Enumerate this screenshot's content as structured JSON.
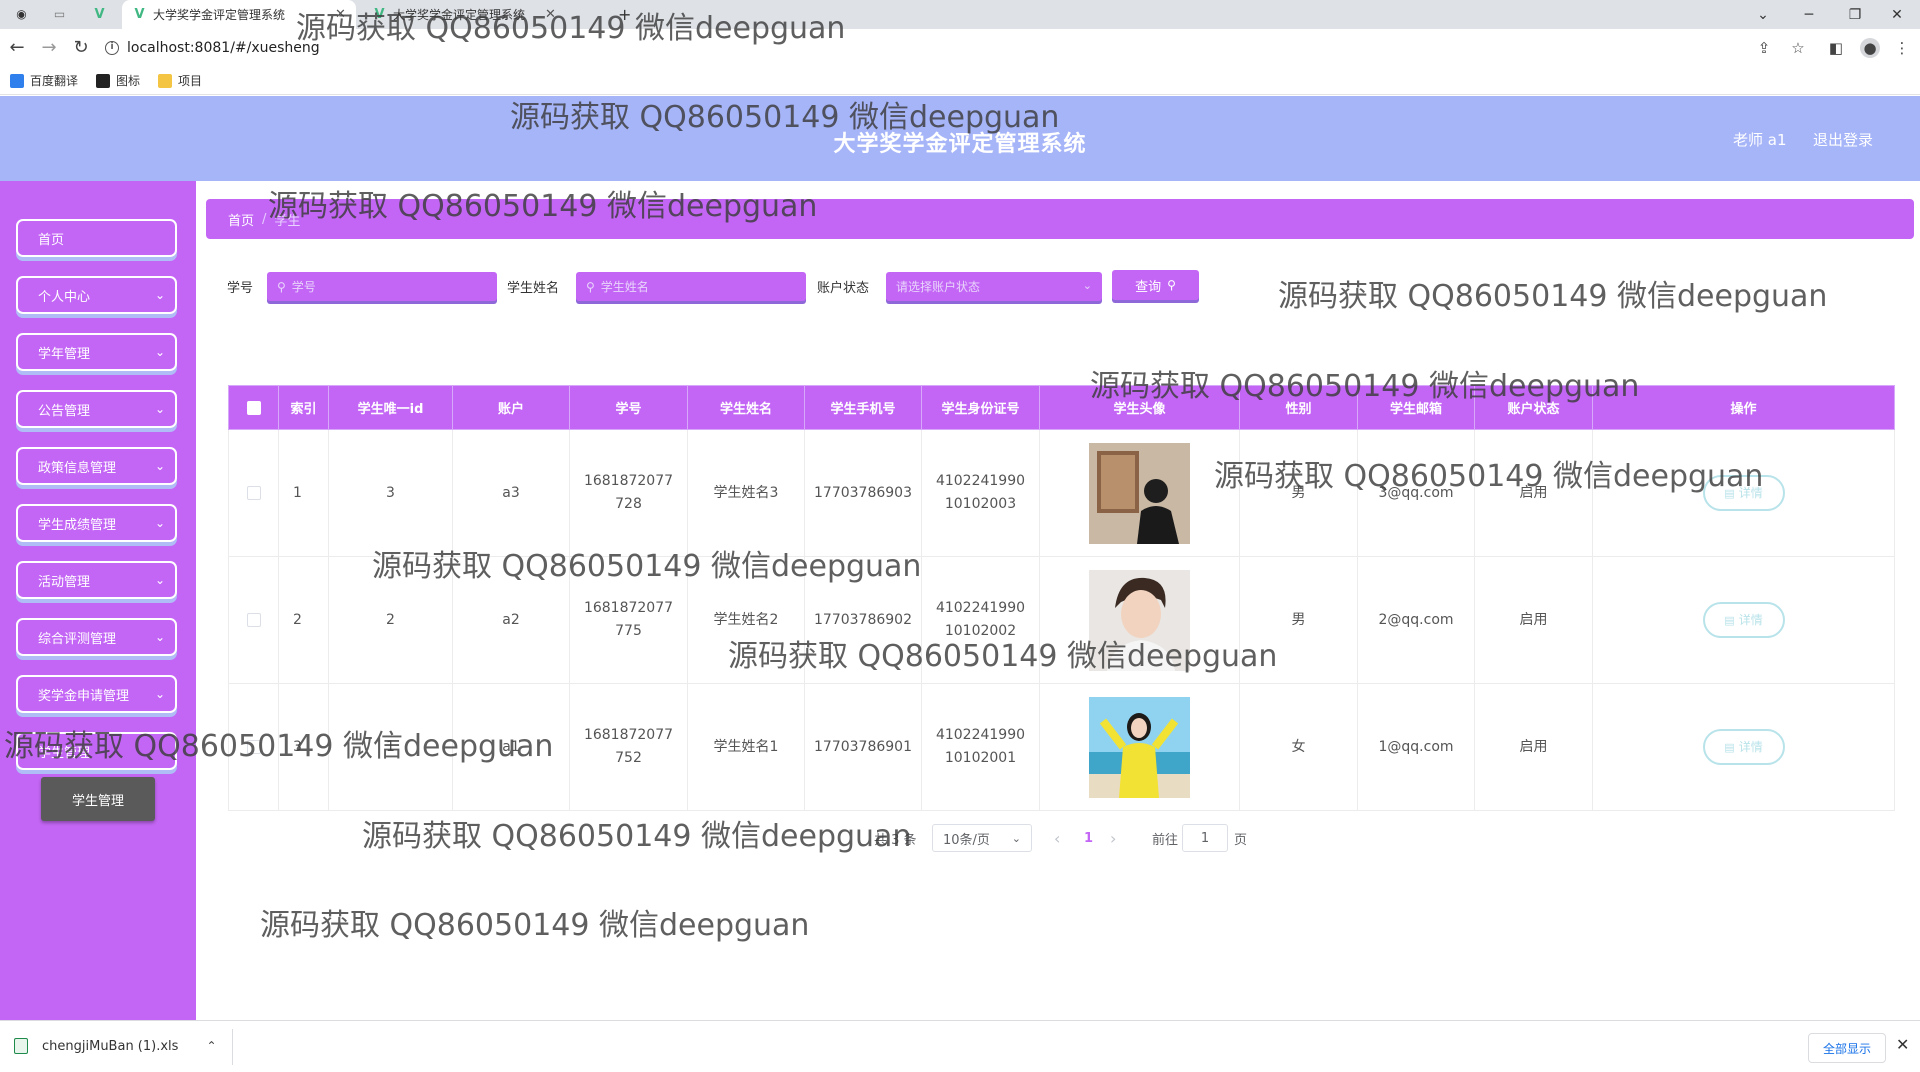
{
  "browser": {
    "tabs": [
      {
        "title": "大学奖学金评定管理系统",
        "close": "✕"
      },
      {
        "title": "大学奖学金评定管理系统",
        "close": "✕"
      }
    ],
    "new_tab": "+",
    "url": "localhost:8081/#/xuesheng",
    "bookmarks": [
      "百度翻译",
      "图标",
      "项目"
    ],
    "window_controls": {
      "minimize": "─",
      "maximize": "❐",
      "close": "✕",
      "dropdown": "⌄"
    }
  },
  "header": {
    "title": "大学奖学金评定管理系统",
    "user": "老师 a1",
    "logout": "退出登录"
  },
  "sidebar": {
    "items": [
      {
        "label": "首页",
        "chevron": ""
      },
      {
        "label": "个人中心",
        "chevron": "⌄"
      },
      {
        "label": "学年管理",
        "chevron": "⌄"
      },
      {
        "label": "公告管理",
        "chevron": "⌄"
      },
      {
        "label": "政策信息管理",
        "chevron": "⌄"
      },
      {
        "label": "学生成绩管理",
        "chevron": "⌄"
      },
      {
        "label": "活动管理",
        "chevron": "⌄"
      },
      {
        "label": "综合评测管理",
        "chevron": "⌄"
      },
      {
        "label": "奖学金申请管理",
        "chevron": "⌄"
      },
      {
        "label": "学生管理",
        "chevron": "⌄"
      }
    ],
    "active_sub": "学生管理"
  },
  "breadcrumb": {
    "home": "首页",
    "separator": "/",
    "current": "学生"
  },
  "search": {
    "student_no_label": "学号",
    "student_no_placeholder": "学号",
    "student_name_label": "学生姓名",
    "student_name_placeholder": "学生姓名",
    "status_label": "账户状态",
    "status_placeholder": "请选择账户状态",
    "query_button": "查询"
  },
  "table": {
    "columns": [
      "索引",
      "学生唯一id",
      "账户",
      "学号",
      "学生姓名",
      "学生手机号",
      "学生身份证号",
      "学生头像",
      "性别",
      "学生邮箱",
      "账户状态",
      "操作"
    ],
    "rows": [
      {
        "index": "1",
        "id": "3",
        "account": "a3",
        "no": "1681872077728",
        "name": "学生姓名3",
        "phone": "17703786903",
        "idcard": "410224199010102003",
        "gender": "男",
        "email": "3@qq.com",
        "status": "启用",
        "action": "详情"
      },
      {
        "index": "2",
        "id": "2",
        "account": "a2",
        "no": "1681872077775",
        "name": "学生姓名2",
        "phone": "17703786902",
        "idcard": "410224199010102002",
        "gender": "男",
        "email": "2@qq.com",
        "status": "启用",
        "action": "详情"
      },
      {
        "index": "3",
        "id": "1",
        "account": "a1",
        "no": "1681872077752",
        "name": "学生姓名1",
        "phone": "17703786901",
        "idcard": "410224199010102001",
        "gender": "女",
        "email": "1@qq.com",
        "status": "启用",
        "action": "详情"
      }
    ]
  },
  "pagination": {
    "total": "共 3 条",
    "page_size": "10条/页",
    "prev": "‹",
    "current": "1",
    "next": "›",
    "goto_label": "前往",
    "goto_value": "1",
    "page_suffix": "页"
  },
  "watermark": "源码获取 QQ86050149 微信deepguan",
  "downloads": {
    "file": "chengjiMuBan (1).xls",
    "show_all": "全部显示",
    "close": "✕"
  },
  "colors": {
    "primary": "#c466f5",
    "header_bg": "#a6b4f8",
    "detail_btn": "#b8e3ea"
  }
}
